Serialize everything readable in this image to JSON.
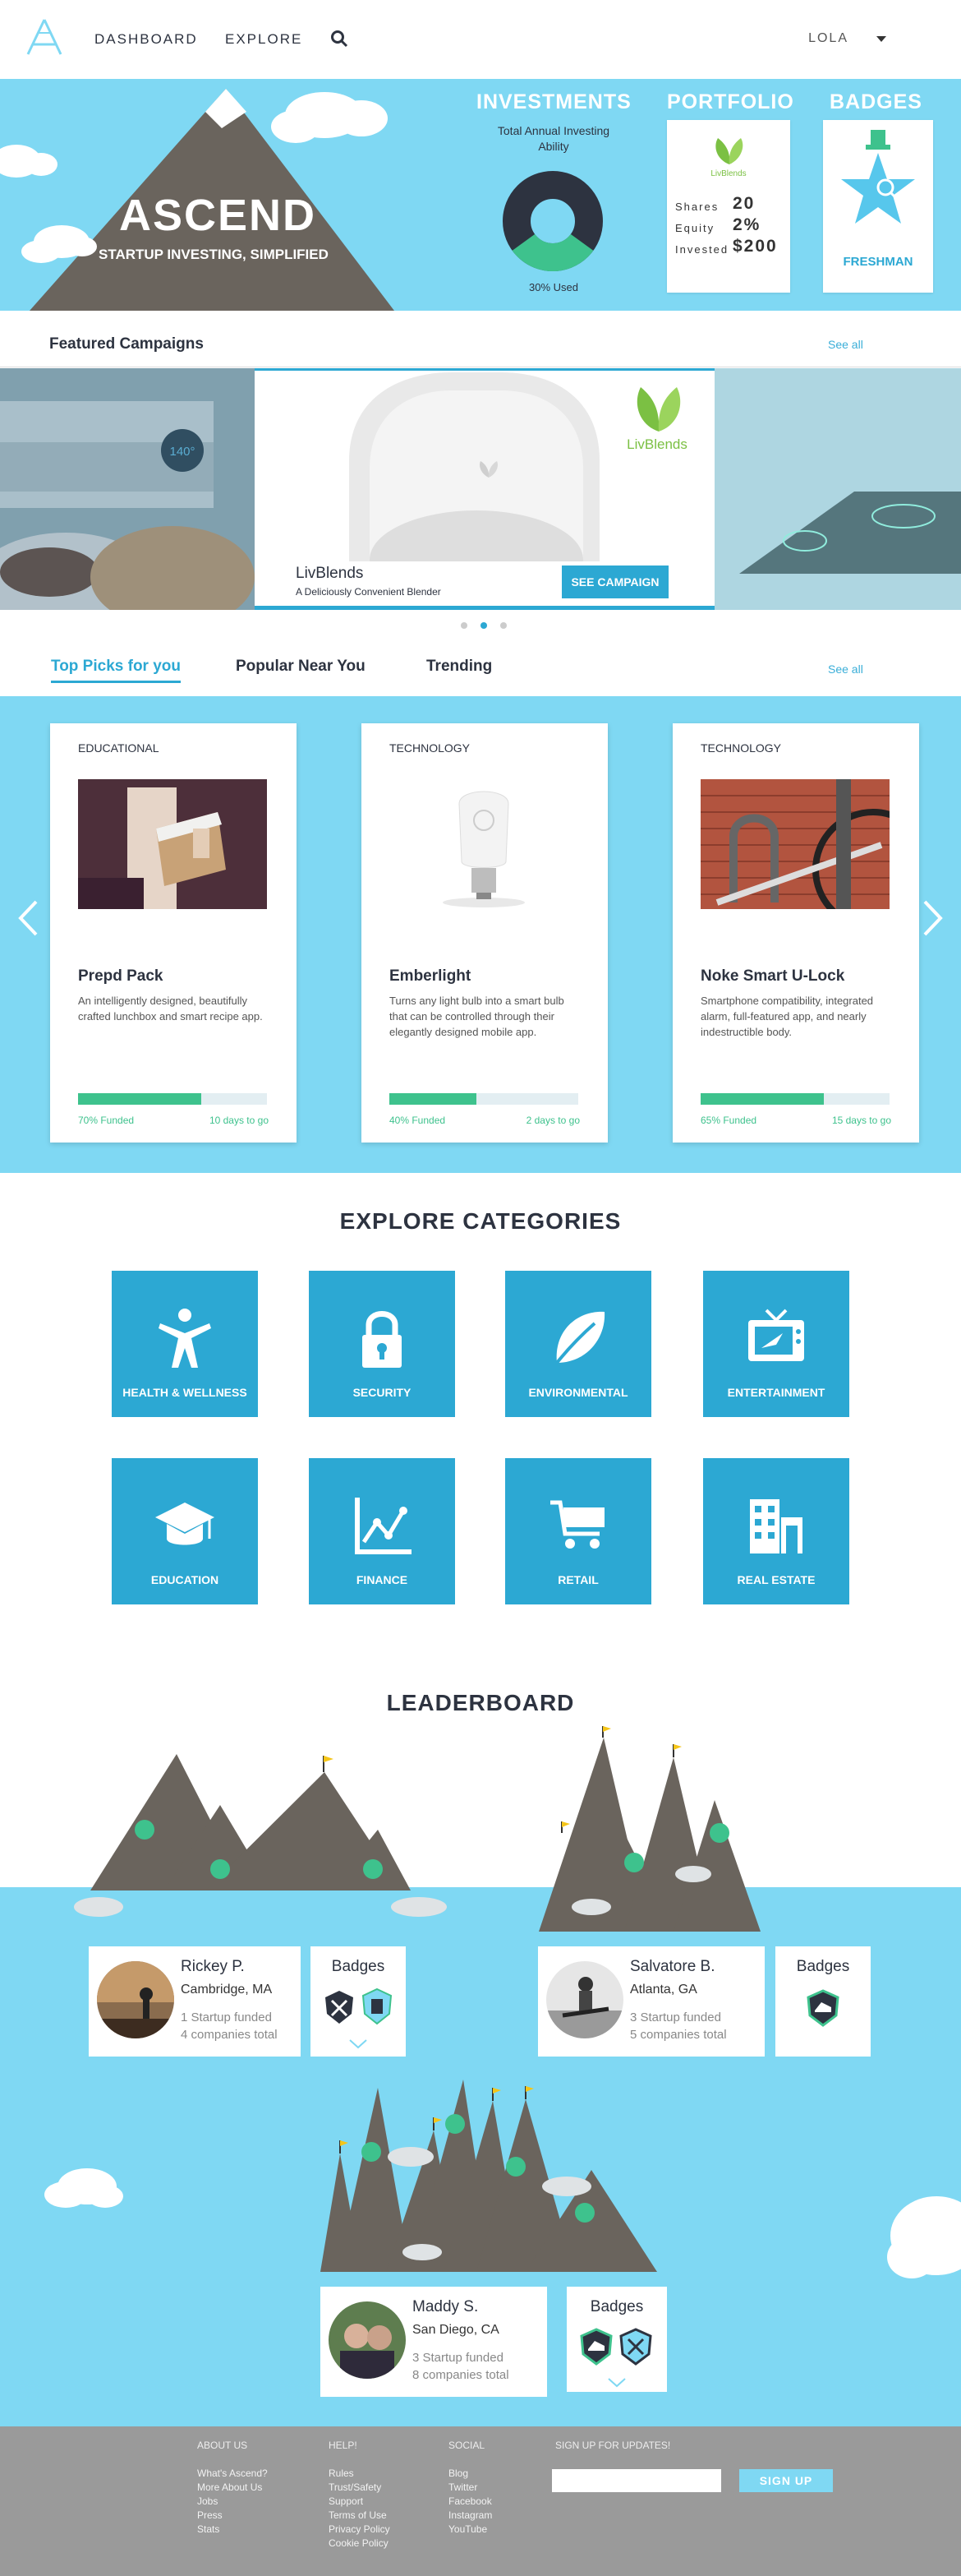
{
  "nav": {
    "dashboard": "DASHBOARD",
    "explore": "EXPLORE",
    "user": "LOLA"
  },
  "hero": {
    "title": "ASCEND",
    "subtitle": "STARTUP INVESTING, SIMPLIFIED",
    "investments": {
      "title": "INVESTMENTS",
      "caption": "Total Annual Investing Ability",
      "used": "30% Used",
      "used_fraction": 0.3
    },
    "portfolio": {
      "title": "PORTFOLIO",
      "brand": "LivBlends",
      "rows": [
        {
          "label": "Shares",
          "value": "20"
        },
        {
          "label": "Equity",
          "value": "2%"
        },
        {
          "label": "Invested",
          "value": "$200"
        }
      ]
    },
    "badges": {
      "title": "BADGES",
      "badge": "FRESHMAN"
    }
  },
  "featured": {
    "title": "Featured Campaigns",
    "see_all": "See all",
    "campaign_name": "LivBlends",
    "campaign_tagline": "A Deliciously Convenient Blender",
    "campaign_button": "SEE CAMPAIGN",
    "brand": "LivBlends",
    "oven_display": "140°"
  },
  "picks": {
    "tabs": [
      "Top Picks for you",
      "Popular Near You",
      "Trending"
    ],
    "see_all": "See all",
    "cards": [
      {
        "category": "EDUCATIONAL",
        "name": "Prepd Pack",
        "desc": "An intelligently designed, beautifully crafted lunchbox and smart recipe app.",
        "funded": "70% Funded",
        "funded_fraction": 0.65,
        "days": "10 days to go"
      },
      {
        "category": "TECHNOLOGY",
        "name": "Emberlight",
        "desc": "Turns any light bulb into a smart bulb that can be controlled through their elegantly designed mobile app.",
        "funded": "40% Funded",
        "funded_fraction": 0.46,
        "days": "2 days to go"
      },
      {
        "category": "TECHNOLOGY",
        "name": "Noke Smart U-Lock",
        "desc": "Smartphone compatibility, integrated alarm, full-featured app, and nearly indestructible body.",
        "funded": "65% Funded",
        "funded_fraction": 0.65,
        "days": "15 days to go"
      }
    ]
  },
  "categories": {
    "title": "EXPLORE CATEGORIES",
    "items": [
      "HEALTH & WELLNESS",
      "SECURITY",
      "ENVIRONMENTAL",
      "ENTERTAINMENT",
      "EDUCATION",
      "FINANCE",
      "RETAIL",
      "REAL ESTATE"
    ]
  },
  "leaderboard": {
    "title": "LEADERBOARD",
    "badges_label": "Badges",
    "leaders": [
      {
        "name": "Rickey P.",
        "location": "Cambridge, MA",
        "funded": "1 Startup funded",
        "total": "4 companies total"
      },
      {
        "name": "Salvatore B.",
        "location": "Atlanta, GA",
        "funded": "3 Startup funded",
        "total": "5 companies total"
      },
      {
        "name": "Maddy S.",
        "location": "San Diego, CA",
        "funded": "3 Startup funded",
        "total": "8 companies total"
      }
    ]
  },
  "footer": {
    "about": {
      "heading": "ABOUT US",
      "links": [
        "What's Ascend?",
        "More About Us",
        "Jobs",
        "Press",
        "Stats"
      ]
    },
    "help": {
      "heading": "HELP!",
      "links": [
        "Rules",
        "Trust/Safety",
        "Support",
        "Terms of Use",
        "Privacy Policy",
        "Cookie Policy"
      ]
    },
    "social": {
      "heading": "SOCIAL",
      "links": [
        "Blog",
        "Twitter",
        "Facebook",
        "Instagram",
        "YouTube"
      ]
    },
    "signup": {
      "heading": "SIGN UP FOR UPDATES!",
      "button": "SIGN UP",
      "placeholder": ""
    }
  },
  "colors": {
    "accent": "#2ca8d3",
    "sky": "#7fd8f3",
    "green": "#3ec28d",
    "dark": "#2d3340"
  }
}
